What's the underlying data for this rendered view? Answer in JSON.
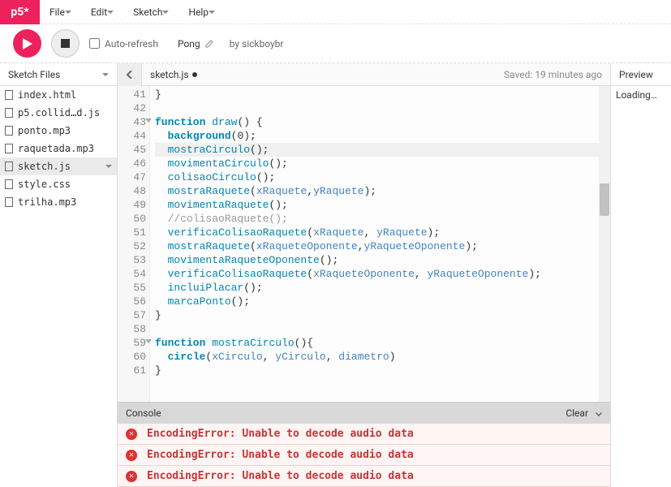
{
  "logo": "p5*",
  "menus": [
    "File",
    "Edit",
    "Sketch",
    "Help"
  ],
  "toolbar": {
    "autorefresh_label": "Auto-refresh",
    "sketch_name": "Pong",
    "author_prefix": "by",
    "author": "sickboybr"
  },
  "sidebar": {
    "title": "Sketch Files",
    "files": [
      {
        "name": "index.html",
        "active": false
      },
      {
        "name": "p5.collid…d.js",
        "active": false
      },
      {
        "name": "ponto.mp3",
        "active": false
      },
      {
        "name": "raquetada.mp3",
        "active": false
      },
      {
        "name": "sketch.js",
        "active": true
      },
      {
        "name": "style.css",
        "active": false
      },
      {
        "name": "trilha.mp3",
        "active": false
      }
    ]
  },
  "editor": {
    "tab": "sketch.js",
    "saved": "Saved: 19 minutes ago",
    "first_line_no": 41,
    "highlighted_line": 45,
    "fold_lines": [
      43,
      59
    ],
    "lines": [
      [
        {
          "t": "}",
          "c": ""
        }
      ],
      [],
      [
        {
          "t": "function",
          "c": "kw"
        },
        {
          "t": " ",
          "c": ""
        },
        {
          "t": "draw",
          "c": "fn"
        },
        {
          "t": "() {",
          "c": ""
        }
      ],
      [
        {
          "t": "  ",
          "c": ""
        },
        {
          "t": "background",
          "c": "fnb"
        },
        {
          "t": "(",
          "c": ""
        },
        {
          "t": "0",
          "c": "num"
        },
        {
          "t": ");",
          "c": ""
        }
      ],
      [
        {
          "t": "  ",
          "c": ""
        },
        {
          "t": "mostraCirculo",
          "c": "fn"
        },
        {
          "t": "();",
          "c": ""
        }
      ],
      [
        {
          "t": "  ",
          "c": ""
        },
        {
          "t": "movimentaCirculo",
          "c": "fn"
        },
        {
          "t": "();",
          "c": ""
        }
      ],
      [
        {
          "t": "  ",
          "c": ""
        },
        {
          "t": "colisaoCirculo",
          "c": "fn"
        },
        {
          "t": "();",
          "c": ""
        }
      ],
      [
        {
          "t": "  ",
          "c": ""
        },
        {
          "t": "mostraRaquete",
          "c": "fn"
        },
        {
          "t": "(",
          "c": ""
        },
        {
          "t": "xRaquete",
          "c": "ident"
        },
        {
          "t": ",",
          "c": ""
        },
        {
          "t": "yRaquete",
          "c": "ident"
        },
        {
          "t": ");",
          "c": ""
        }
      ],
      [
        {
          "t": "  ",
          "c": ""
        },
        {
          "t": "movimentaRaquete",
          "c": "fn"
        },
        {
          "t": "();",
          "c": ""
        }
      ],
      [
        {
          "t": "  ",
          "c": ""
        },
        {
          "t": "//colisaoRaquete();",
          "c": "cmt"
        }
      ],
      [
        {
          "t": "  ",
          "c": ""
        },
        {
          "t": "verificaColisaoRaquete",
          "c": "fn"
        },
        {
          "t": "(",
          "c": ""
        },
        {
          "t": "xRaquete",
          "c": "ident"
        },
        {
          "t": ", ",
          "c": ""
        },
        {
          "t": "yRaquete",
          "c": "ident"
        },
        {
          "t": ");",
          "c": ""
        }
      ],
      [
        {
          "t": "  ",
          "c": ""
        },
        {
          "t": "mostraRaquete",
          "c": "fn"
        },
        {
          "t": "(",
          "c": ""
        },
        {
          "t": "xRaqueteOponente",
          "c": "ident"
        },
        {
          "t": ",",
          "c": ""
        },
        {
          "t": "yRaqueteOponente",
          "c": "ident"
        },
        {
          "t": ");",
          "c": ""
        }
      ],
      [
        {
          "t": "  ",
          "c": ""
        },
        {
          "t": "movimentaRaqueteOponente",
          "c": "fn"
        },
        {
          "t": "();",
          "c": ""
        }
      ],
      [
        {
          "t": "  ",
          "c": ""
        },
        {
          "t": "verificaColisaoRaquete",
          "c": "fn"
        },
        {
          "t": "(",
          "c": ""
        },
        {
          "t": "xRaqueteOponente",
          "c": "ident"
        },
        {
          "t": ", ",
          "c": ""
        },
        {
          "t": "yRaqueteOponente",
          "c": "ident"
        },
        {
          "t": ");",
          "c": ""
        }
      ],
      [
        {
          "t": "  ",
          "c": ""
        },
        {
          "t": "incluiPlacar",
          "c": "fn"
        },
        {
          "t": "();",
          "c": ""
        }
      ],
      [
        {
          "t": "  ",
          "c": ""
        },
        {
          "t": "marcaPonto",
          "c": "fn"
        },
        {
          "t": "();",
          "c": ""
        }
      ],
      [
        {
          "t": "}",
          "c": ""
        }
      ],
      [],
      [
        {
          "t": "function",
          "c": "kw"
        },
        {
          "t": " ",
          "c": ""
        },
        {
          "t": "mostraCirculo",
          "c": "fn"
        },
        {
          "t": "(){",
          "c": ""
        }
      ],
      [
        {
          "t": "  ",
          "c": ""
        },
        {
          "t": "circle",
          "c": "fnb"
        },
        {
          "t": "(",
          "c": ""
        },
        {
          "t": "xCirculo",
          "c": "ident"
        },
        {
          "t": ", ",
          "c": ""
        },
        {
          "t": "yCirculo",
          "c": "ident"
        },
        {
          "t": ", ",
          "c": ""
        },
        {
          "t": "diametro",
          "c": "ident"
        },
        {
          "t": ")",
          "c": ""
        }
      ],
      [
        {
          "t": "}",
          "c": ""
        }
      ]
    ]
  },
  "console": {
    "title": "Console",
    "clear": "Clear",
    "rows": [
      "EncodingError: Unable to decode audio data",
      "EncodingError: Unable to decode audio data",
      "EncodingError: Unable to decode audio data"
    ]
  },
  "preview": {
    "title": "Preview",
    "body": "Loading…"
  }
}
